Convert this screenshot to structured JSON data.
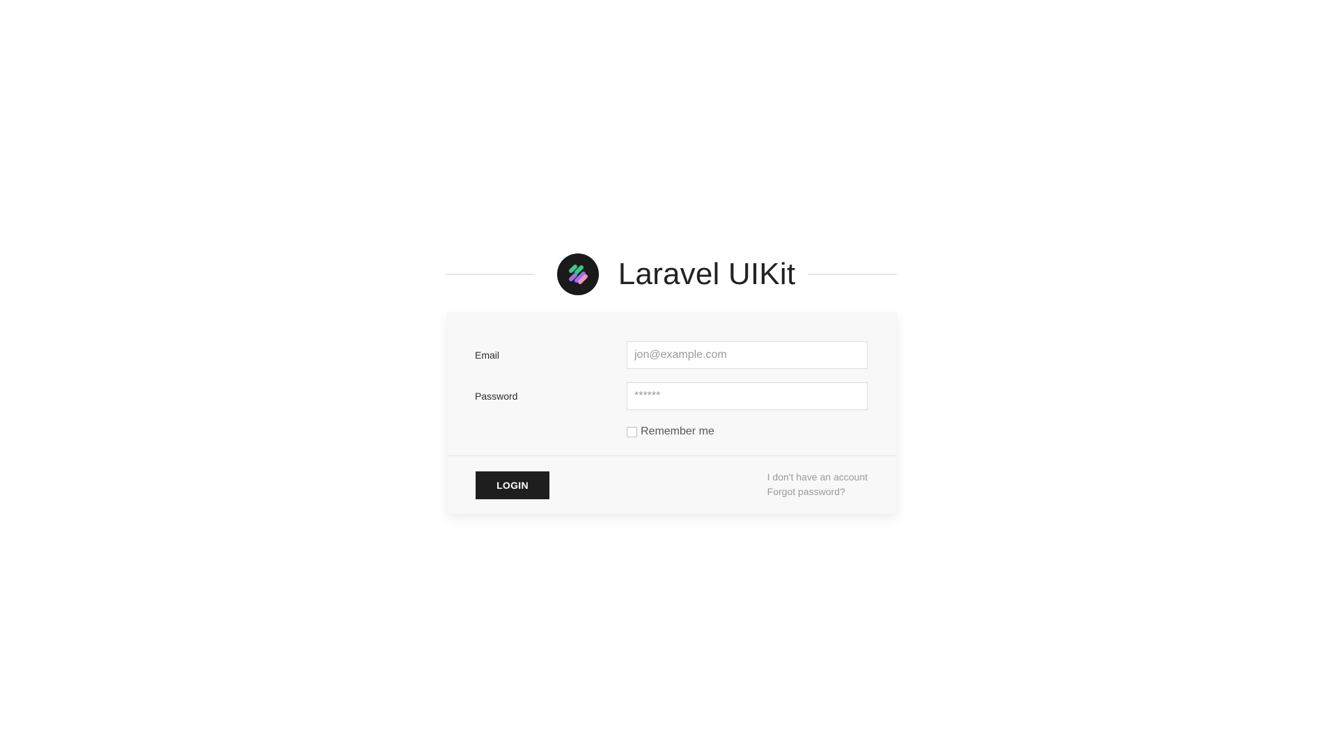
{
  "brand": {
    "title": "Laravel UIKit",
    "logo_icon": "logo-icon",
    "logo_colors": [
      "#35c98f",
      "#a46cf0",
      "#f39aa6"
    ]
  },
  "form": {
    "email_label": "Email",
    "email_placeholder": "jon@example.com",
    "password_label": "Password",
    "password_placeholder": "******",
    "remember_label": "Remember me",
    "remember_checked": false
  },
  "footer": {
    "login_label": "LOGIN",
    "register_link": "I don't have an account",
    "forgot_link": "Forgot password?"
  },
  "colors": {
    "page_bg": "#ffffff",
    "card_bg": "#f8f8f8",
    "button_bg": "#1e1e1e",
    "link_color": "#999999"
  }
}
